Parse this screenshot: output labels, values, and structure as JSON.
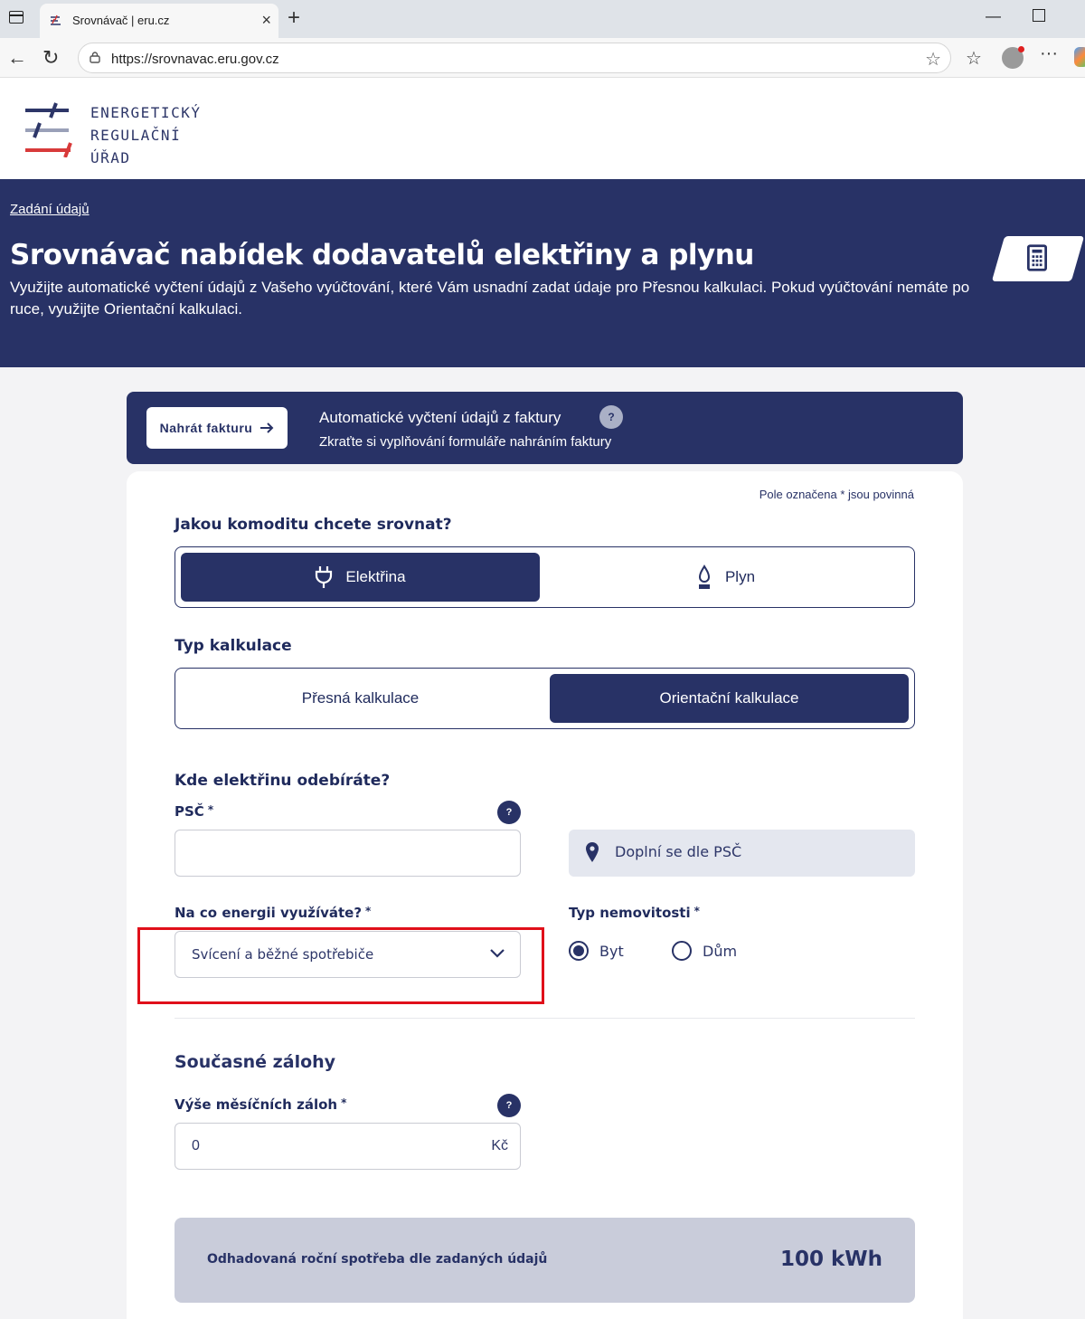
{
  "browser": {
    "tab_title": "Srovnávač | eru.cz",
    "url": "https://srovnavac.eru.gov.cz"
  },
  "header": {
    "logo_line1": "ENERGETICKÝ",
    "logo_line2": "REGULAČNÍ",
    "logo_line3": "ÚŘAD"
  },
  "hero": {
    "breadcrumb": "Zadání údajů",
    "title": "Srovnávač nabídek dodavatelů elektřiny a plynu",
    "description": "Využijte automatické vyčtení údajů z Vašeho vyúčtování, které Vám usnadní zadat údaje pro Přesnou kalkulaci. Pokud vyúčtování nemáte po ruce, využijte Orientační kalkulaci."
  },
  "upload": {
    "button_label": "Nahrát fakturu",
    "title": "Automatické vyčtení údajů z faktury",
    "subtitle": "Zkraťte si vyplňování formuláře nahráním faktury",
    "help": "?"
  },
  "form": {
    "required_note": "Pole označena * jsou povinná",
    "commodity": {
      "title": "Jakou komoditu chcete srovnat?",
      "options": [
        "Elektřina",
        "Plyn"
      ],
      "selected": "Elektřina"
    },
    "calc_type": {
      "title": "Typ kalkulace",
      "options": [
        "Přesná kalkulace",
        "Orientační kalkulace"
      ],
      "selected": "Orientační kalkulace"
    },
    "location": {
      "title": "Kde elektřinu odebíráte?",
      "psc_label": "PSČ",
      "psc_value": "",
      "auto_fill": "Doplní se dle PSČ"
    },
    "usage": {
      "label": "Na co energii využíváte?",
      "value": "Svícení a běžné spotřebiče"
    },
    "property": {
      "label": "Typ nemovitosti",
      "options": [
        "Byt",
        "Dům"
      ],
      "selected": "Byt"
    },
    "deposits": {
      "title": "Současné zálohy",
      "label": "Výše měsíčních záloh",
      "value": "0",
      "unit": "Kč"
    },
    "estimate": {
      "label": "Odhadovaná roční spotřeba dle zadaných údajů",
      "value": "100 kWh"
    },
    "required_mark": "*",
    "help": "?"
  }
}
